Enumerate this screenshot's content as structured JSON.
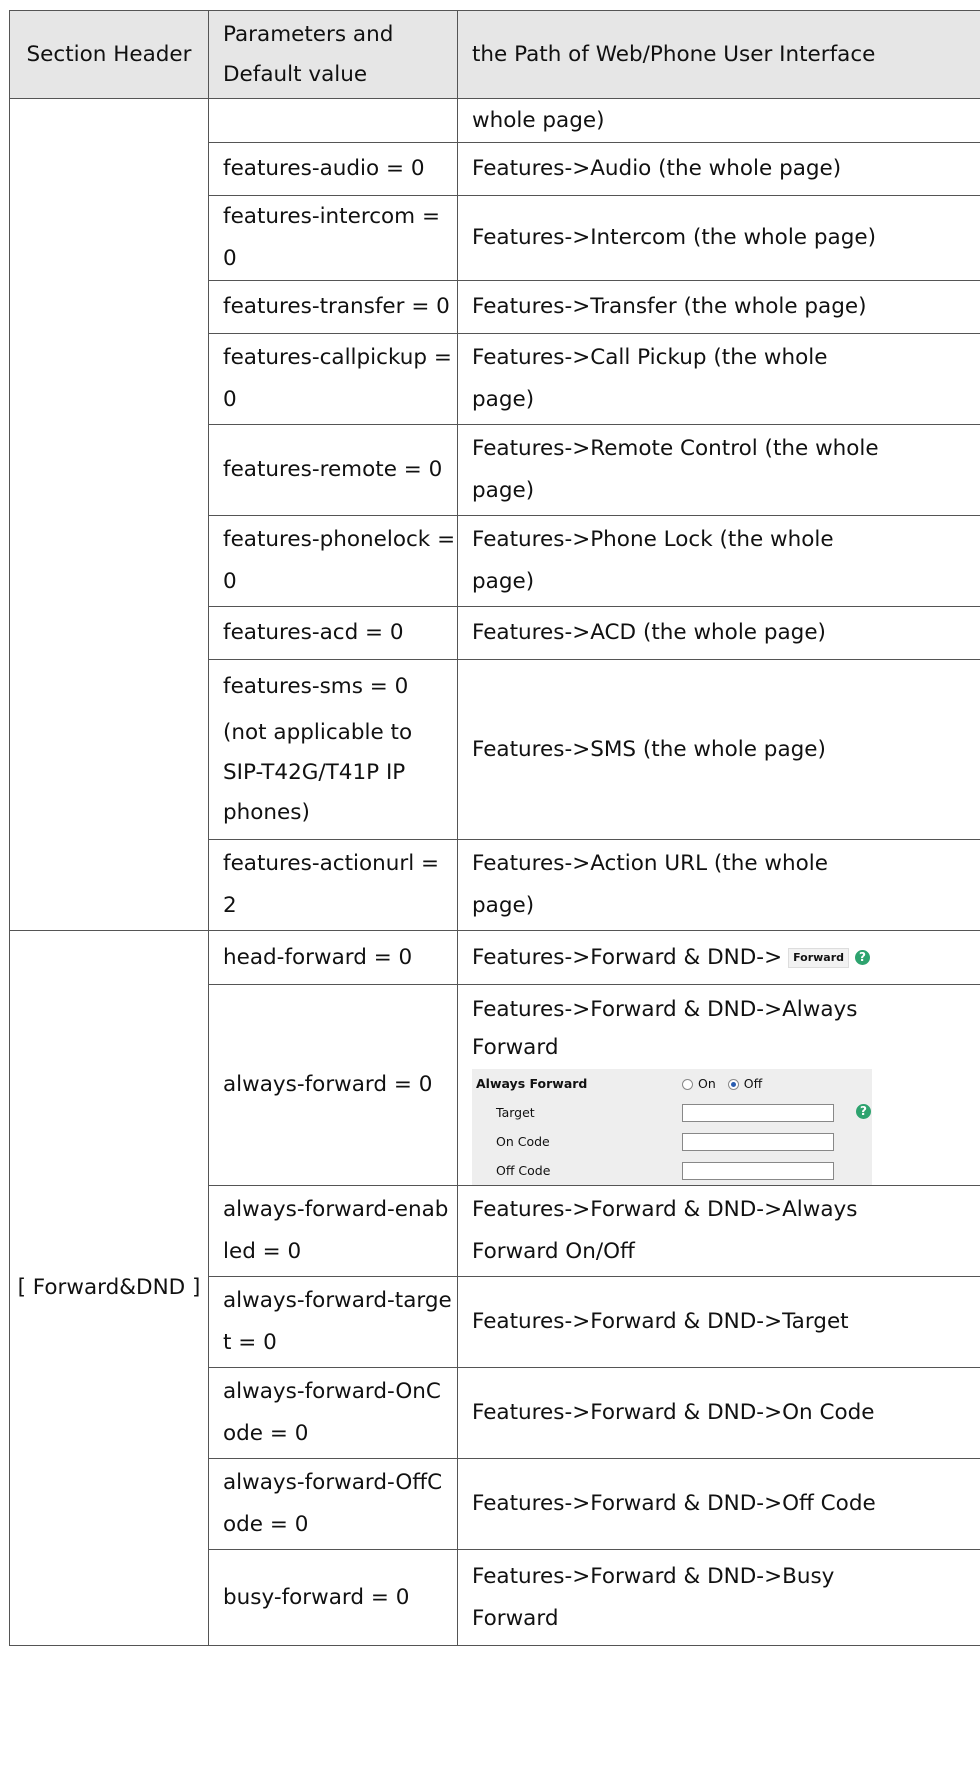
{
  "headers": {
    "section": "Section Header",
    "params_line1": "Parameters and",
    "params_line2": "Default value",
    "path": "the Path of Web/Phone User Interface"
  },
  "rows": [
    {
      "param": [
        ""
      ],
      "path": [
        "whole page)"
      ]
    },
    {
      "param": [
        "features-audio = 0"
      ],
      "path": [
        "Features->Audio (the whole page)"
      ]
    },
    {
      "param": [
        "features-intercom = 0"
      ],
      "path": [
        "Features->Intercom (the whole page)"
      ]
    },
    {
      "param": [
        "features-transfer = 0"
      ],
      "path": [
        "Features->Transfer (the whole page)"
      ]
    },
    {
      "param": [
        "features-callpickup =",
        "0"
      ],
      "path": [
        "Features->Call Pickup (the whole",
        "page)"
      ]
    },
    {
      "param": [
        "features-remote = 0"
      ],
      "path": [
        "Features->Remote Control (the whole",
        "page)"
      ]
    },
    {
      "param": [
        "features-phonelock =",
        "0"
      ],
      "path": [
        "Features->Phone Lock (the whole",
        "page)"
      ]
    },
    {
      "param": [
        "features-acd = 0"
      ],
      "path": [
        "Features->ACD (the whole page)"
      ]
    },
    {
      "param": [
        "features-sms = 0",
        "(not applicable to",
        "SIP-T42G/T41P IP",
        "phones)"
      ],
      "path": [
        "Features->SMS (the whole page)"
      ]
    },
    {
      "param": [
        "features-actionurl = 2"
      ],
      "path": [
        "Features->Action URL (the whole",
        "page)"
      ]
    }
  ],
  "forward_section": {
    "label": "[ Forward&DND ]",
    "head_forward": {
      "param": "head-forward = 0",
      "path": "Features->Forward & DND->",
      "img_label": "Forward",
      "help": "?"
    },
    "always_forward": {
      "param": "always-forward = 0",
      "path_line1": "Features->Forward & DND->Always",
      "path_line2": "Forward",
      "box": {
        "title": "Always Forward",
        "on": "On",
        "off": "Off",
        "target": "Target",
        "on_code": "On Code",
        "off_code": "Off Code",
        "help": "?"
      }
    },
    "rows": [
      {
        "param": [
          "always-forward-enab",
          "led = 0"
        ],
        "path": [
          "Features->Forward & DND->Always",
          "Forward On/Off"
        ]
      },
      {
        "param": [
          "always-forward-targe",
          "t = 0"
        ],
        "path": [
          "Features->Forward & DND->Target"
        ]
      },
      {
        "param": [
          "always-forward-OnC",
          "ode = 0"
        ],
        "path": [
          "Features->Forward & DND->On Code"
        ]
      },
      {
        "param": [
          "always-forward-OffC",
          "ode = 0"
        ],
        "path": [
          "Features->Forward & DND->Off Code"
        ]
      },
      {
        "param": [
          "busy-forward = 0"
        ],
        "path": [
          "Features->Forward & DND->Busy",
          "Forward"
        ]
      }
    ]
  }
}
